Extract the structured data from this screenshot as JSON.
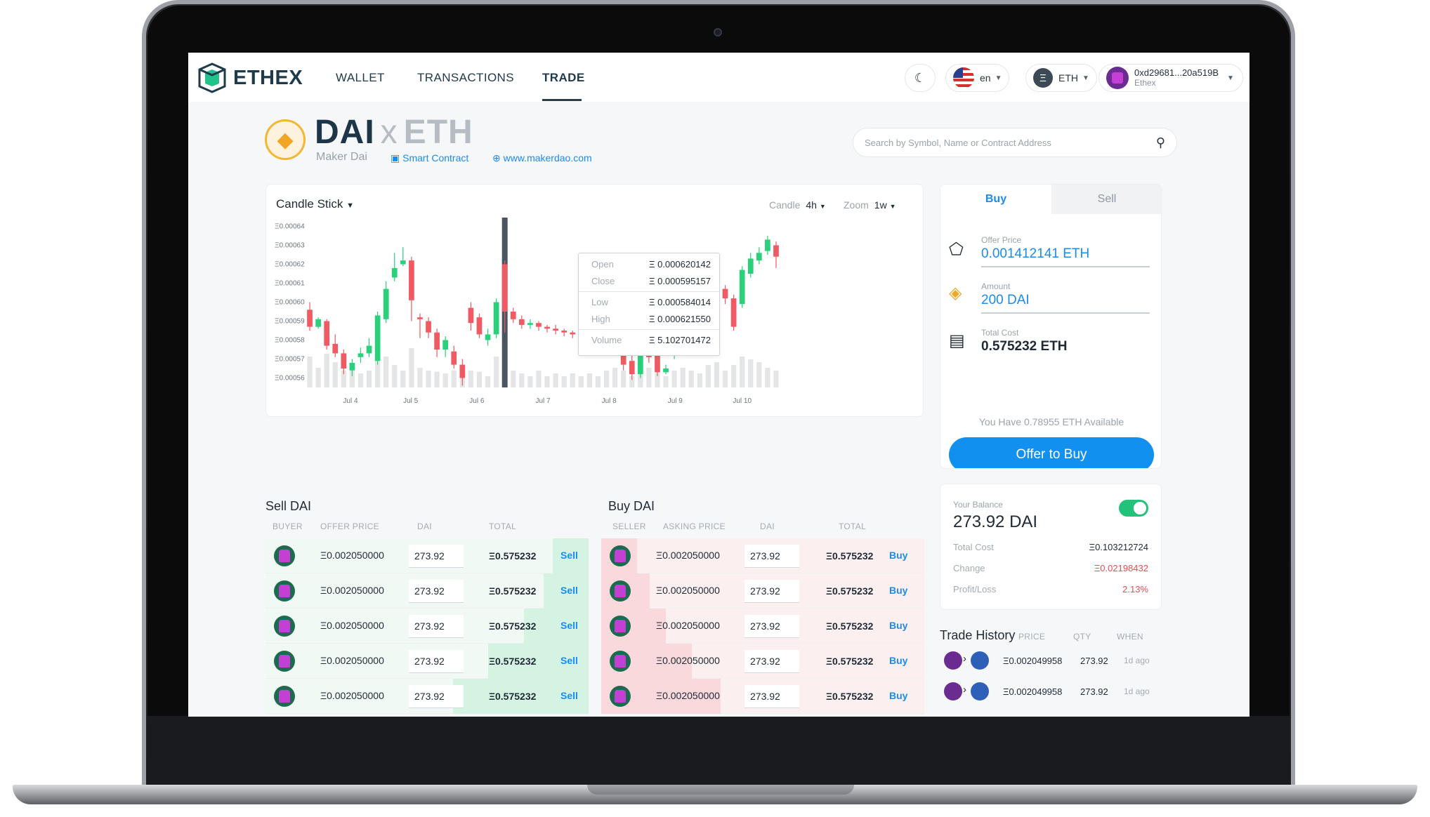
{
  "nav": {
    "brand": "ETHEX",
    "links": [
      "WALLET",
      "TRANSACTIONS",
      "TRADE"
    ],
    "language": "en",
    "currency": "ETH",
    "account_address": "0xd29681...20a519B",
    "account_sub": "Ethex"
  },
  "token": {
    "symbol": "DAI",
    "pair_x": "x",
    "quote": "ETH",
    "name": "Maker Dai",
    "contract_link": "Smart Contract",
    "website": "www.makerdao.com"
  },
  "search": {
    "placeholder": "Search by Symbol, Name or Contract Address"
  },
  "chart_header": {
    "title": "Candle Stick",
    "candle_label": "Candle",
    "candle_value": "4h",
    "zoom_label": "Zoom",
    "zoom_value": "1w"
  },
  "tooltip": {
    "open_label": "Open",
    "open": "Ξ 0.000620142",
    "close_label": "Close",
    "close": "Ξ 0.000595157",
    "low_label": "Low",
    "low": "Ξ 0.000584014",
    "high_label": "High",
    "high": "Ξ 0.000621550",
    "volume_label": "Volume",
    "volume": "Ξ 5.102701472"
  },
  "chart_data": {
    "type": "candlestick",
    "yticks": [
      "Ξ0.00064",
      "Ξ0.00063",
      "Ξ0.00062",
      "Ξ0.00061",
      "Ξ0.00060",
      "Ξ0.00059",
      "Ξ0.00058",
      "Ξ0.00057",
      "Ξ0.00056"
    ],
    "xticks": [
      {
        "label": "Jul 4",
        "at": 5.3
      },
      {
        "label": "Jul 5",
        "at": 12.4
      },
      {
        "label": "Jul 6",
        "at": 20.2
      },
      {
        "label": "Jul 7",
        "at": 28
      },
      {
        "label": "Jul 8",
        "at": 35.8
      },
      {
        "label": "Jul 9",
        "at": 43.6
      },
      {
        "label": "Jul 10",
        "at": 51.5
      }
    ],
    "ylim": [
      0.000555,
      0.000645
    ],
    "colors": {
      "up": "#2bd07b",
      "down": "#f05a63",
      "volume": "#e4e5e7"
    },
    "candles": [
      [
        0.000596,
        0.000587,
        0.0006,
        0.000585,
        0.55
      ],
      [
        0.000587,
        0.000591,
        0.000592,
        0.000586,
        0.35
      ],
      [
        0.00059,
        0.000577,
        0.000591,
        0.000575,
        0.6
      ],
      [
        0.000578,
        0.000573,
        0.000583,
        0.000571,
        0.45
      ],
      [
        0.000573,
        0.000565,
        0.000575,
        0.000562,
        0.3
      ],
      [
        0.000564,
        0.000568,
        0.00057,
        0.000561,
        0.38
      ],
      [
        0.000571,
        0.000573,
        0.000576,
        0.000568,
        0.25
      ],
      [
        0.000573,
        0.000577,
        0.000581,
        0.000571,
        0.3
      ],
      [
        0.000569,
        0.000593,
        0.000595,
        0.000567,
        0.5
      ],
      [
        0.000591,
        0.000607,
        0.000611,
        0.000589,
        0.55
      ],
      [
        0.000613,
        0.000618,
        0.000626,
        0.000611,
        0.4
      ],
      [
        0.00062,
        0.000622,
        0.000629,
        0.000619,
        0.3
      ],
      [
        0.000622,
        0.000601,
        0.000624,
        0.00059,
        0.7
      ],
      [
        0.000592,
        0.000591,
        0.000594,
        0.000581,
        0.35
      ],
      [
        0.00059,
        0.000584,
        0.000592,
        0.000581,
        0.3
      ],
      [
        0.000584,
        0.000575,
        0.000586,
        0.000571,
        0.28
      ],
      [
        0.000575,
        0.00058,
        0.000582,
        0.000571,
        0.25
      ],
      [
        0.000574,
        0.000567,
        0.000577,
        0.000565,
        0.3
      ],
      [
        0.000567,
        0.00056,
        0.00057,
        0.000556,
        0.2
      ],
      [
        0.000597,
        0.000589,
        0.0006,
        0.000585,
        0.3
      ],
      [
        0.000592,
        0.000583,
        0.000594,
        0.000581,
        0.28
      ],
      [
        0.00058,
        0.000583,
        0.000586,
        0.000577,
        0.2
      ],
      [
        0.000583,
        0.0006,
        0.000602,
        0.000581,
        0.55
      ],
      [
        0.00062,
        0.000595,
        0.000622,
        0.000584,
        0.9
      ],
      [
        0.000595,
        0.000591,
        0.000597,
        0.000589,
        0.3
      ],
      [
        0.000591,
        0.000588,
        0.000593,
        0.000586,
        0.25
      ],
      [
        0.000588,
        0.000589,
        0.000591,
        0.000586,
        0.2
      ],
      [
        0.000589,
        0.000587,
        0.00059,
        0.000585,
        0.3
      ],
      [
        0.000587,
        0.000586,
        0.000588,
        0.000584,
        0.2
      ],
      [
        0.000586,
        0.000585,
        0.000588,
        0.000583,
        0.25
      ],
      [
        0.000585,
        0.000584,
        0.000586,
        0.000582,
        0.2
      ],
      [
        0.000584,
        0.000583,
        0.000585,
        0.000581,
        0.25
      ],
      [
        0.000583,
        0.000581,
        0.000584,
        0.00058,
        0.2
      ],
      [
        0.000581,
        0.000582,
        0.000583,
        0.000579,
        0.25
      ],
      [
        0.000582,
        0.00058,
        0.000583,
        0.000578,
        0.2
      ],
      [
        0.00058,
        0.000579,
        0.000582,
        0.000577,
        0.3
      ],
      [
        0.000584,
        0.000576,
        0.000586,
        0.000573,
        0.35
      ],
      [
        0.000576,
        0.000567,
        0.000578,
        0.000564,
        0.3
      ],
      [
        0.000569,
        0.000562,
        0.000572,
        0.000559,
        0.2
      ],
      [
        0.000562,
        0.000576,
        0.000577,
        0.00056,
        0.3
      ],
      [
        0.000576,
        0.000571,
        0.000578,
        0.000568,
        0.35
      ],
      [
        0.000572,
        0.000563,
        0.000574,
        0.000561,
        0.25
      ],
      [
        0.000563,
        0.000565,
        0.000567,
        0.000562,
        0.2
      ],
      [
        0.000572,
        0.000583,
        0.000584,
        0.00057,
        0.3
      ],
      [
        0.000583,
        0.000581,
        0.000587,
        0.000578,
        0.35
      ],
      [
        0.000575,
        0.000584,
        0.000588,
        0.000573,
        0.3
      ],
      [
        0.000577,
        0.000581,
        0.000585,
        0.000575,
        0.25
      ],
      [
        0.000582,
        0.000592,
        0.000594,
        0.00058,
        0.4
      ],
      [
        0.000596,
        0.000607,
        0.00061,
        0.000594,
        0.45
      ],
      [
        0.000607,
        0.000602,
        0.000609,
        0.000599,
        0.3
      ],
      [
        0.000602,
        0.000587,
        0.000604,
        0.000585,
        0.4
      ],
      [
        0.000599,
        0.000617,
        0.000619,
        0.000597,
        0.55
      ],
      [
        0.000615,
        0.000623,
        0.000626,
        0.000613,
        0.5
      ],
      [
        0.000622,
        0.000626,
        0.000629,
        0.00062,
        0.45
      ],
      [
        0.000627,
        0.000633,
        0.000635,
        0.000625,
        0.35
      ],
      [
        0.00063,
        0.000624,
        0.000632,
        0.000618,
        0.3
      ]
    ]
  },
  "trade": {
    "tab_buy": "Buy",
    "tab_sell": "Sell",
    "offer_label": "Offer Price",
    "offer_value": "0.001412141 ETH",
    "amount_label": "Amount",
    "amount_value": "200 DAI",
    "total_label": "Total Cost",
    "total_value": "0.575232 ETH",
    "available": "You Have 0.78955 ETH Available",
    "button": "Offer to Buy"
  },
  "balance": {
    "label": "Your Balance",
    "value": "273.92 DAI",
    "total_cost_label": "Total Cost",
    "total_cost": "Ξ0.103212724",
    "change_label": "Change",
    "change": "Ξ0.02198432",
    "pl_label": "Profit/Loss",
    "pl": "2.13%"
  },
  "history": {
    "title": "Trade History",
    "cols": [
      "PRICE",
      "QTY",
      "WHEN"
    ],
    "rows": [
      {
        "price": "Ξ0.002049958",
        "qty": "273.92",
        "when": "1d ago"
      },
      {
        "price": "Ξ0.002049958",
        "qty": "273.92",
        "when": "1d ago"
      }
    ]
  },
  "sell_book": {
    "title": "Sell DAI",
    "cols": [
      "BUYER",
      "OFFER PRICE",
      "DAI",
      "TOTAL"
    ],
    "rows": [
      {
        "price": "Ξ0.002050000",
        "qty": "273.92",
        "total": "Ξ0.575232",
        "action": "Sell",
        "depth": 0.11
      },
      {
        "price": "Ξ0.002050000",
        "qty": "273.92",
        "total": "Ξ0.575232",
        "action": "Sell",
        "depth": 0.14
      },
      {
        "price": "Ξ0.002050000",
        "qty": "273.92",
        "total": "Ξ0.575232",
        "action": "Sell",
        "depth": 0.2
      },
      {
        "price": "Ξ0.002050000",
        "qty": "273.92",
        "total": "Ξ0.575232",
        "action": "Sell",
        "depth": 0.31
      },
      {
        "price": "Ξ0.002050000",
        "qty": "273.92",
        "total": "Ξ0.575232",
        "action": "Sell",
        "depth": 0.42
      }
    ]
  },
  "buy_book": {
    "title": "Buy DAI",
    "cols": [
      "SELLER",
      "ASKING PRICE",
      "DAI",
      "TOTAL"
    ],
    "rows": [
      {
        "price": "Ξ0.002050000",
        "qty": "273.92",
        "total": "Ξ0.575232",
        "action": "Buy",
        "depth": 0.11
      },
      {
        "price": "Ξ0.002050000",
        "qty": "273.92",
        "total": "Ξ0.575232",
        "action": "Buy",
        "depth": 0.15
      },
      {
        "price": "Ξ0.002050000",
        "qty": "273.92",
        "total": "Ξ0.575232",
        "action": "Buy",
        "depth": 0.2
      },
      {
        "price": "Ξ0.002050000",
        "qty": "273.92",
        "total": "Ξ0.575232",
        "action": "Buy",
        "depth": 0.28
      },
      {
        "price": "Ξ0.002050000",
        "qty": "273.92",
        "total": "Ξ0.575232",
        "action": "Buy",
        "depth": 0.37
      }
    ]
  }
}
